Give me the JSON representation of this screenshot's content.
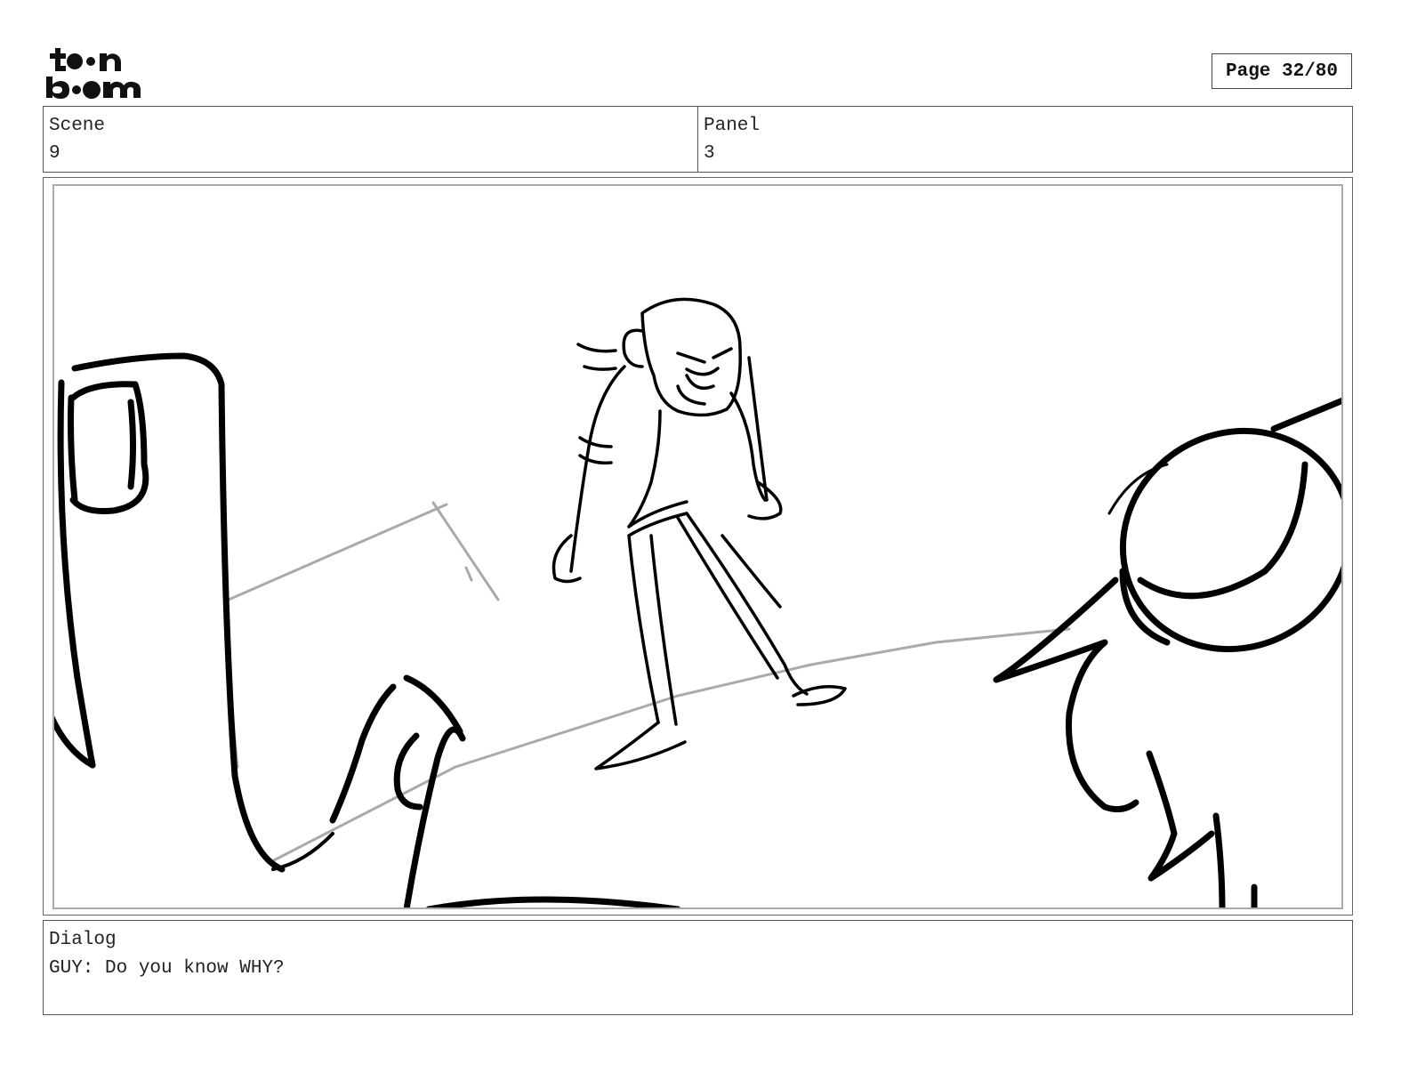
{
  "header": {
    "logo_line1": "toon",
    "logo_line2": "boom",
    "page_label": "Page 32/80"
  },
  "info": {
    "scene_label": "Scene",
    "scene_value": "9",
    "panel_label": "Panel",
    "panel_value": "3"
  },
  "dialog": {
    "label": "Dialog",
    "text": "GUY: Do you know WHY?"
  }
}
